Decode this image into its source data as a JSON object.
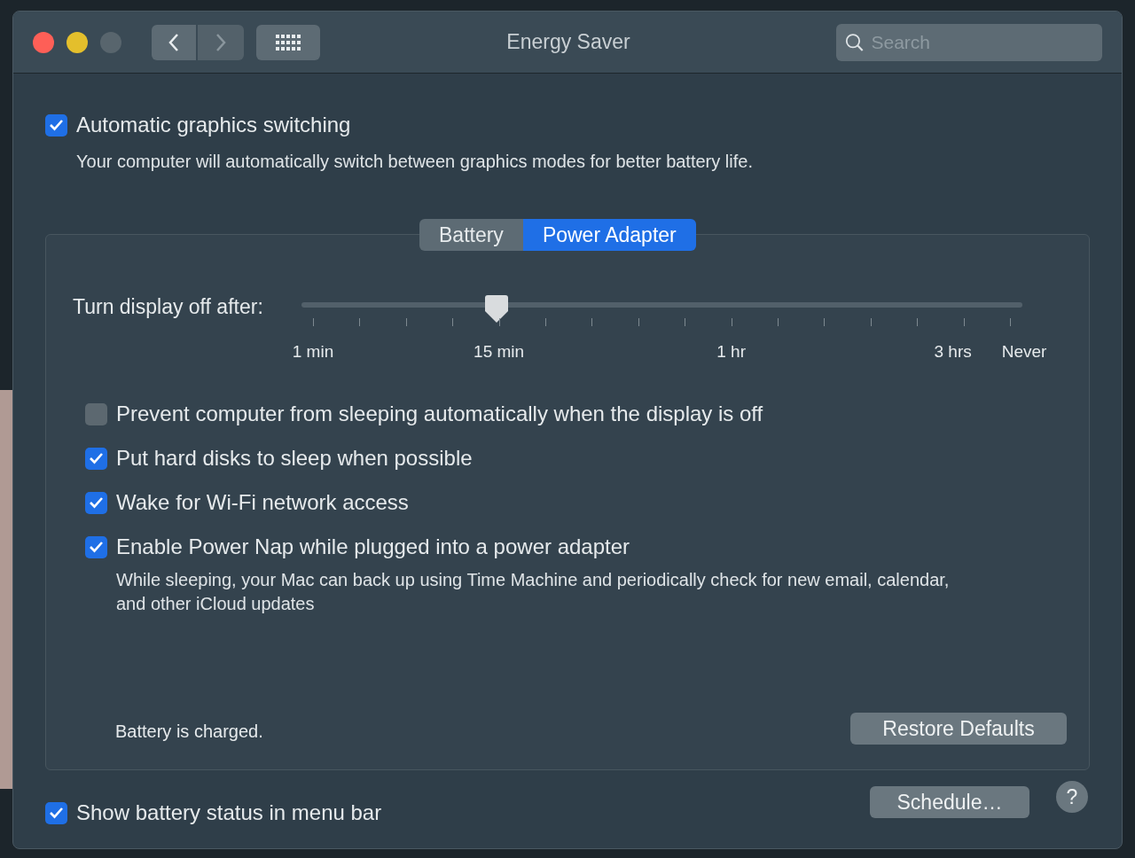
{
  "window": {
    "title": "Energy Saver",
    "search": {
      "placeholder": "Search"
    }
  },
  "graphics_switching": {
    "label": "Automatic graphics switching",
    "checked": true,
    "description": "Your computer will automatically switch between graphics modes for better battery life."
  },
  "tabs": [
    {
      "label": "Battery",
      "selected": false
    },
    {
      "label": "Power Adapter",
      "selected": true
    }
  ],
  "display_slider": {
    "label": "Turn display off after:",
    "level": 0.27,
    "tick_labels": [
      "1 min",
      "15 min",
      "1 hr",
      "3 hrs",
      "Never"
    ]
  },
  "options": [
    {
      "label": "Prevent computer from sleeping automatically when the display is off",
      "checked": false
    },
    {
      "label": "Put hard disks to sleep when possible",
      "checked": true
    },
    {
      "label": "Wake for Wi-Fi network access",
      "checked": true
    },
    {
      "label": "Enable Power Nap while plugged into a power adapter",
      "checked": true,
      "description": "While sleeping, your Mac can back up using Time Machine and periodically check for new email, calendar, and other iCloud updates"
    }
  ],
  "status": "Battery is charged.",
  "restore_button": "Restore Defaults",
  "menu_bar_option": {
    "label": "Show battery status in menu bar",
    "checked": true
  },
  "schedule_button": "Schedule…",
  "help_button": "?"
}
